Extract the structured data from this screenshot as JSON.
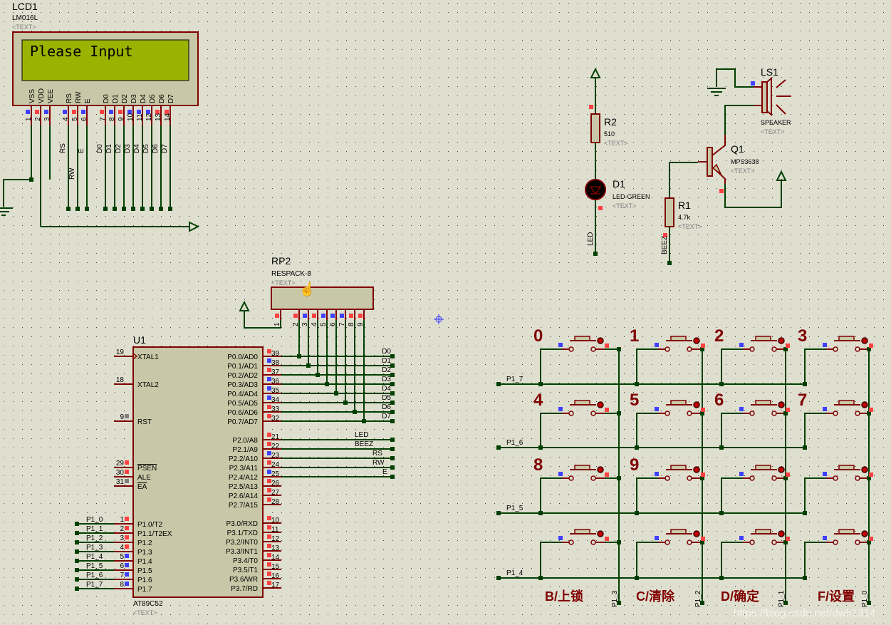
{
  "colors": {
    "background": "#dfdfd0",
    "wire": "#004000",
    "component": "#800000",
    "body_fill": "#c8c8a8",
    "lcd_screen": "#9ab300",
    "pin_red": "#ff4040",
    "pin_blue": "#4040ff",
    "pin_grey": "#808080",
    "hint_text": "#808080"
  },
  "lcd": {
    "ref": "LCD1",
    "model": "LM016L",
    "text": "<TEXT>",
    "display": "Please Input",
    "pins": [
      {
        "l": "VSS",
        "n": "1",
        "s": "b"
      },
      {
        "l": "VDD",
        "n": "2",
        "s": "r"
      },
      {
        "l": "VEE",
        "n": "3",
        "s": "b"
      },
      {
        "l": "RS",
        "n": "4",
        "s": "b"
      },
      {
        "l": "RW",
        "n": "5",
        "s": "r"
      },
      {
        "l": "E",
        "n": "6",
        "s": "b"
      },
      {
        "l": "D0",
        "n": "7",
        "s": "r"
      },
      {
        "l": "D1",
        "n": "8",
        "s": "b"
      },
      {
        "l": "D2",
        "n": "9",
        "s": "r"
      },
      {
        "l": "D3",
        "n": "10",
        "s": "b"
      },
      {
        "l": "D4",
        "n": "11",
        "s": "b"
      },
      {
        "l": "D5",
        "n": "12",
        "s": "b"
      },
      {
        "l": "D6",
        "n": "13",
        "s": "r"
      },
      {
        "l": "D7",
        "n": "14",
        "s": "r"
      }
    ],
    "net_labels": [
      "RS",
      "RW",
      "E",
      "D0",
      "D1",
      "D2",
      "D3",
      "D4",
      "D5",
      "D6",
      "D7"
    ]
  },
  "rp2": {
    "ref": "RP2",
    "model": "RESPACK-8",
    "text": "<TEXT>",
    "pins": [
      {
        "n": "1",
        "s": "r"
      },
      {
        "n": "2",
        "s": "r"
      },
      {
        "n": "3",
        "s": "b"
      },
      {
        "n": "4",
        "s": "r"
      },
      {
        "n": "5",
        "s": "b"
      },
      {
        "n": "6",
        "s": "b"
      },
      {
        "n": "7",
        "s": "b"
      },
      {
        "n": "8",
        "s": "r"
      },
      {
        "n": "9",
        "s": "r"
      }
    ]
  },
  "u1": {
    "ref": "U1",
    "model": "AT89C52",
    "text": "<TEXT>",
    "left_pins": [
      {
        "n": "19",
        "l": "XTAL1",
        "s": ""
      },
      {
        "n": "18",
        "l": "XTAL2",
        "s": ""
      },
      {
        "n": "9",
        "l": "RST",
        "s": "g"
      },
      {
        "n": "29",
        "l": "PSEN",
        "s": "r"
      },
      {
        "n": "30",
        "l": "ALE",
        "s": "r"
      },
      {
        "n": "31",
        "l": "EA",
        "s": "g"
      },
      {
        "n": "1",
        "l": "P1.0/T2",
        "s": "r"
      },
      {
        "n": "2",
        "l": "P1.1/T2EX",
        "s": "r"
      },
      {
        "n": "3",
        "l": "P1.2",
        "s": "r"
      },
      {
        "n": "4",
        "l": "P1.3",
        "s": "r"
      },
      {
        "n": "5",
        "l": "P1.4",
        "s": "b"
      },
      {
        "n": "6",
        "l": "P1.5",
        "s": "b"
      },
      {
        "n": "7",
        "l": "P1.6",
        "s": "b"
      },
      {
        "n": "8",
        "l": "P1.7",
        "s": "b"
      }
    ],
    "right_pins": [
      {
        "n": "39",
        "l": "P0.0/AD0",
        "s": "r"
      },
      {
        "n": "38",
        "l": "P0.1/AD1",
        "s": "b"
      },
      {
        "n": "37",
        "l": "P0.2/AD2",
        "s": "r"
      },
      {
        "n": "36",
        "l": "P0.3/AD3",
        "s": "b"
      },
      {
        "n": "35",
        "l": "P0.4/AD4",
        "s": "b"
      },
      {
        "n": "34",
        "l": "P0.5/AD5",
        "s": "b"
      },
      {
        "n": "33",
        "l": "P0.6/AD6",
        "s": "r"
      },
      {
        "n": "32",
        "l": "P0.7/AD7",
        "s": "r"
      },
      {
        "n": "21",
        "l": "P2.0/A8",
        "s": "r"
      },
      {
        "n": "22",
        "l": "P2.1/A9",
        "s": "r"
      },
      {
        "n": "23",
        "l": "P2.2/A10",
        "s": "b"
      },
      {
        "n": "24",
        "l": "P2.3/A11",
        "s": "r"
      },
      {
        "n": "25",
        "l": "P2.4/A12",
        "s": "b"
      },
      {
        "n": "26",
        "l": "P2.5/A13",
        "s": "r"
      },
      {
        "n": "27",
        "l": "P2.6/A14",
        "s": "r"
      },
      {
        "n": "28",
        "l": "P2.7/A15",
        "s": "r"
      },
      {
        "n": "10",
        "l": "P3.0/RXD",
        "s": "r"
      },
      {
        "n": "11",
        "l": "P3.1/TXD",
        "s": "r"
      },
      {
        "n": "12",
        "l": "P3.2/INT0",
        "s": "r"
      },
      {
        "n": "13",
        "l": "P3.3/INT1",
        "s": "r"
      },
      {
        "n": "14",
        "l": "P3.4/T0",
        "s": "r"
      },
      {
        "n": "15",
        "l": "P3.5/T1",
        "s": "r"
      },
      {
        "n": "16",
        "l": "P3.6/WR",
        "s": "r"
      },
      {
        "n": "17",
        "l": "P3.7/RD",
        "s": "r"
      }
    ],
    "p0_nets": [
      "D0",
      "D1",
      "D2",
      "D3",
      "D4",
      "D5",
      "D6",
      "D7"
    ],
    "p2_nets": [
      "LED",
      "BEEZ",
      "RS",
      "RW",
      "E"
    ],
    "p1_nets": [
      "P1_0",
      "P1_1",
      "P1_2",
      "P1_3",
      "P1_4",
      "P1_5",
      "P1_6",
      "P1_7"
    ]
  },
  "r2": {
    "ref": "R2",
    "value": "510",
    "text": "<TEXT>"
  },
  "d1": {
    "ref": "D1",
    "model": "LED-GREEN",
    "text": "<TEXT>",
    "net": "LED"
  },
  "r1": {
    "ref": "R1",
    "value": "4.7k",
    "text": "<TEXT>",
    "net": "BEEZ"
  },
  "q1": {
    "ref": "Q1",
    "model": "MPS3638",
    "text": "<TEXT>"
  },
  "ls1": {
    "ref": "LS1",
    "model": "SPEAKER",
    "text": "<TEXT>"
  },
  "keypad": {
    "row_nets": [
      "P1_7",
      "P1_6",
      "P1_5",
      "P1_4"
    ],
    "col_nets": [
      "P1_3",
      "P1_2",
      "P1_1",
      "P1_0"
    ],
    "key_labels": [
      "0",
      "1",
      "2",
      "3",
      "4",
      "5",
      "6",
      "7",
      "8",
      "9"
    ],
    "bottom_labels": [
      "B/上锁",
      "C/清除",
      "D/确定",
      "F/设置"
    ]
  },
  "watermark": "https://blog.csdn.net/dwh1314"
}
